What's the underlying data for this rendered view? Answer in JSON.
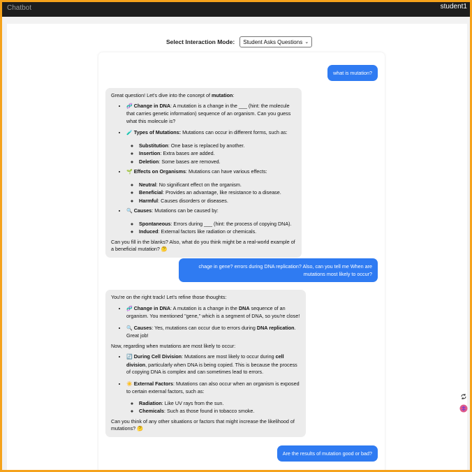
{
  "app": {
    "title": "Chatbot",
    "user": "student1"
  },
  "mode": {
    "label": "Select Interaction Mode:",
    "selected": "Student Asks Questions"
  },
  "messages": {
    "u1": "what is mutation?",
    "b1": {
      "intro_pre": "Great question! Let's dive into the concept of ",
      "intro_bold": "mutation",
      "intro_post": ":",
      "dna_icon": "🧬",
      "dna_title": "Change in DNA",
      "dna_text": ": A mutation is a change in the ___ (hint: the molecule that carries genetic information) sequence of an organism. Can you guess what this molecule is?",
      "types_icon": "🧪",
      "types_title": "Types of Mutations:",
      "types_text": " Mutations can occur in different forms, such as:",
      "sub_title": "Substitution",
      "sub_text": ": One base is replaced by another.",
      "ins_title": "Insertion",
      "ins_text": ": Extra bases are added.",
      "del_title": "Deletion",
      "del_text": ": Some bases are removed.",
      "effects_icon": "🌱",
      "effects_title": "Effects on Organisms",
      "effects_text": ": Mutations can have various effects:",
      "neutral_title": "Neutral",
      "neutral_text": ": No significant effect on the organism.",
      "beneficial_title": "Beneficial",
      "beneficial_text": ": Provides an advantage, like resistance to a disease.",
      "harmful_title": "Harmful",
      "harmful_text": ": Causes disorders or diseases.",
      "causes_icon": "🔍",
      "causes_title": "Causes",
      "causes_text": ": Mutations can be caused by:",
      "spont_title": "Spontaneous",
      "spont_text": ": Errors during ___ (hint: the process of copying DNA).",
      "induced_title": "Induced",
      "induced_text": ": External factors like radiation or chemicals.",
      "outro": "Can you fill in the blanks? Also, what do you think might be a real-world example of a beneficial mutation? 🤔"
    },
    "u2": "chage in gene? errors during DNA replication? Also, can you tell me When are mutations most likely to occur?",
    "b2": {
      "intro": "You're on the right track! Let's refine those thoughts:",
      "dna_icon": "🧬",
      "dna_title": "Change in DNA",
      "dna_text_a": ": A mutation is a change in the ",
      "dna_bold": "DNA",
      "dna_text_b": " sequence of an organism. You mentioned \"gene,\" which is a segment of DNA, so you're close!",
      "causes_icon": "🔍",
      "causes_title": "Causes",
      "causes_text_a": ": Yes, mutations can occur due to errors during ",
      "causes_bold": "DNA replication",
      "causes_text_b": ". Great job!",
      "middle": "Now, regarding when mutations are most likely to occur:",
      "cell_icon": "🔄",
      "cell_title": "During Cell Division",
      "cell_text_a": ": Mutations are most likely to occur during ",
      "cell_bold": "cell division",
      "cell_text_b": ", particularly when DNA is being copied. This is because the process of copying DNA is complex and can sometimes lead to errors.",
      "ext_icon": "☀️",
      "ext_title": "External Factors",
      "ext_text": ": Mutations can also occur when an organism is exposed to certain external factors, such as:",
      "rad_title": "Radiation",
      "rad_text": ": Like UV rays from the sun.",
      "chem_title": "Chemicals",
      "chem_text": ": Such as those found in tobacco smoke.",
      "outro": "Can you think of any other situations or factors that might increase the likelihood of mutations? 🤔"
    },
    "u3": "Are the results of mutation good or bad?"
  },
  "side_icons": {
    "top": "refresh-ai-icon",
    "bottom": "brain-icon"
  }
}
